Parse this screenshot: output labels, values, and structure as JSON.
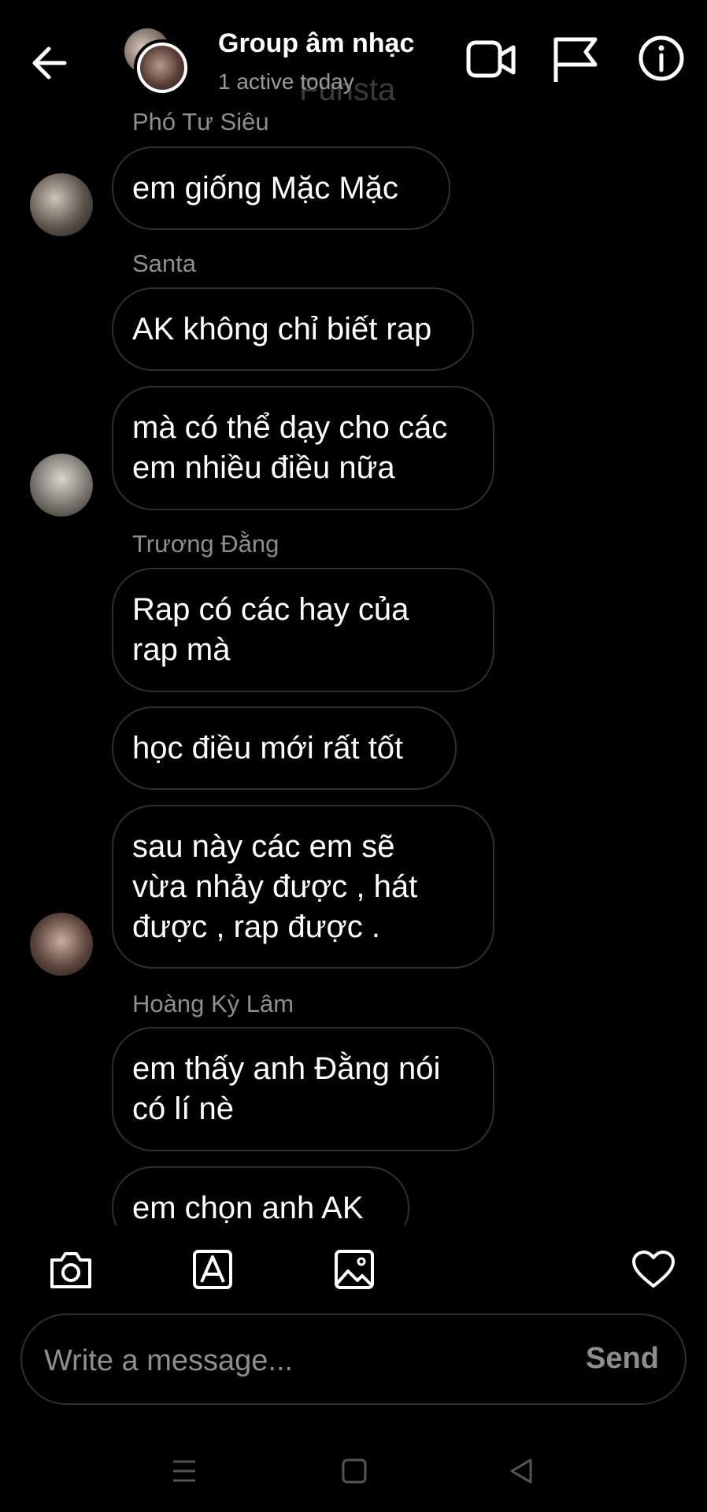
{
  "header": {
    "back_icon": "arrow-left-icon",
    "title": "Group âm nhạc",
    "subtitle": "1 active today",
    "watermark": "Funsta",
    "video_icon": "video-camera-icon",
    "flag_icon": "flag-icon",
    "info_icon": "info-icon"
  },
  "messages": [
    {
      "sender": "Phó Tư Siêu",
      "text": "em giống Mặc Mặc"
    },
    {
      "sender": "Santa",
      "text": "AK không chỉ biết rap"
    },
    {
      "text_lines": [
        "mà có thể dạy cho các",
        "em nhiều điều nữa"
      ]
    },
    {
      "sender": "Trương Đằng",
      "text_lines": [
        "Rap có các hay của",
        "rap mà"
      ]
    },
    {
      "text": "học điều mới rất tốt"
    },
    {
      "text_lines": [
        "sau này các em sẽ",
        "vừa nhảy được , hát",
        "được , rap được ."
      ]
    },
    {
      "sender": "Hoàng Kỳ Lâm",
      "text_lines": [
        "em thấy anh Đằng nói",
        "có lí nè"
      ]
    },
    {
      "text": "em chọn anh AK"
    }
  ],
  "toolbar": {
    "camera_icon": "camera-icon",
    "sticker_icon": "sticker-a-icon",
    "gallery_icon": "image-gallery-icon",
    "like_icon": "heart-icon"
  },
  "composer": {
    "placeholder": "Write a message...",
    "send_label": "Send"
  },
  "navbar": {
    "recent_icon": "recent-apps-icon",
    "home_icon": "home-square-icon",
    "back_icon": "back-triangle-icon"
  },
  "colors": {
    "background": "#000000",
    "bubble_border": "#2f2f2f",
    "muted_text": "#8e8e8e"
  }
}
